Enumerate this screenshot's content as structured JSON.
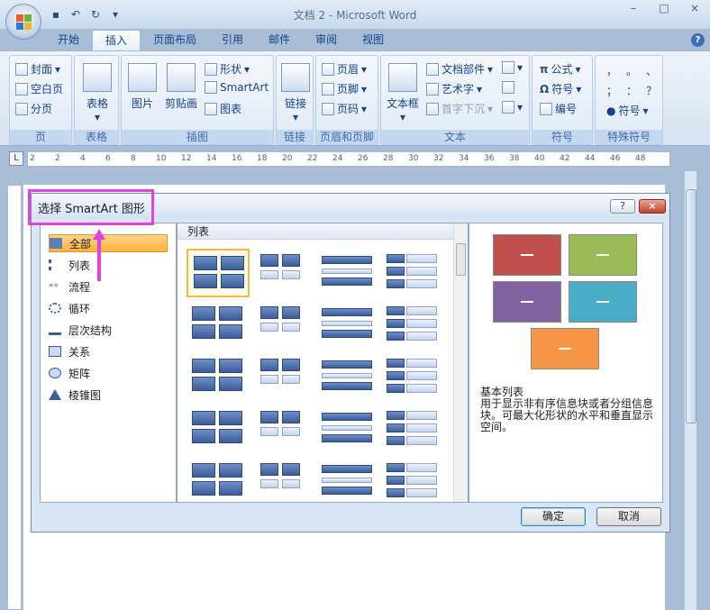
{
  "window": {
    "title": "文档 2 - Microsoft Word",
    "minimize": "–",
    "maximize": "□",
    "close": "×"
  },
  "tabs": [
    "开始",
    "插入",
    "页面布局",
    "引用",
    "邮件",
    "审阅",
    "视图"
  ],
  "active_tab": "插入",
  "ribbon": {
    "pages": {
      "label": "页",
      "items": [
        "封面",
        "空白页",
        "分页"
      ]
    },
    "table": {
      "label": "表格",
      "button": "表格"
    },
    "illustrations": {
      "label": "插图",
      "picture": "图片",
      "clipart": "剪贴画",
      "shapes": "形状",
      "smartart": "SmartArt",
      "chart": "图表"
    },
    "links": {
      "label": "链接",
      "button": "链接"
    },
    "header_footer": {
      "label": "页眉和页脚",
      "items": [
        "页眉",
        "页脚",
        "页码"
      ]
    },
    "text": {
      "label": "文本",
      "textbox": "文本框",
      "items": [
        "文档部件",
        "艺术字",
        "首字下沉"
      ]
    },
    "symbols": {
      "label": "符号",
      "items": [
        "公式",
        "符号",
        "编号"
      ]
    },
    "special": {
      "label": "特殊符号",
      "chars": [
        "，",
        "。",
        "、",
        "；",
        "：",
        "？"
      ],
      "button": "符号"
    }
  },
  "ruler": {
    "ticks": [
      "2",
      "2",
      "4",
      "6",
      "8",
      "10",
      "12",
      "14",
      "16",
      "18",
      "20",
      "22",
      "24",
      "26",
      "28",
      "30",
      "32",
      "34",
      "36",
      "38",
      "40",
      "42",
      "44",
      "46",
      "48"
    ],
    "corner": "L"
  },
  "dialog": {
    "title": "选择 SmartArt 图形",
    "help": "?",
    "close": "×",
    "categories": [
      "全部",
      "列表",
      "流程",
      "循环",
      "层次结构",
      "关系",
      "矩阵",
      "棱锥图"
    ],
    "selected_category": "全部",
    "gallery_header": "列表",
    "preview": {
      "title": "基本列表",
      "description": "用于显示非有序信息块或者分组信息块。可最大化形状的水平和垂直显示空间。",
      "colors": [
        "#c0504d",
        "#9bbb59",
        "#8064a2",
        "#4bacc6",
        "#f79646"
      ]
    },
    "ok": "确定",
    "cancel": "取消"
  }
}
